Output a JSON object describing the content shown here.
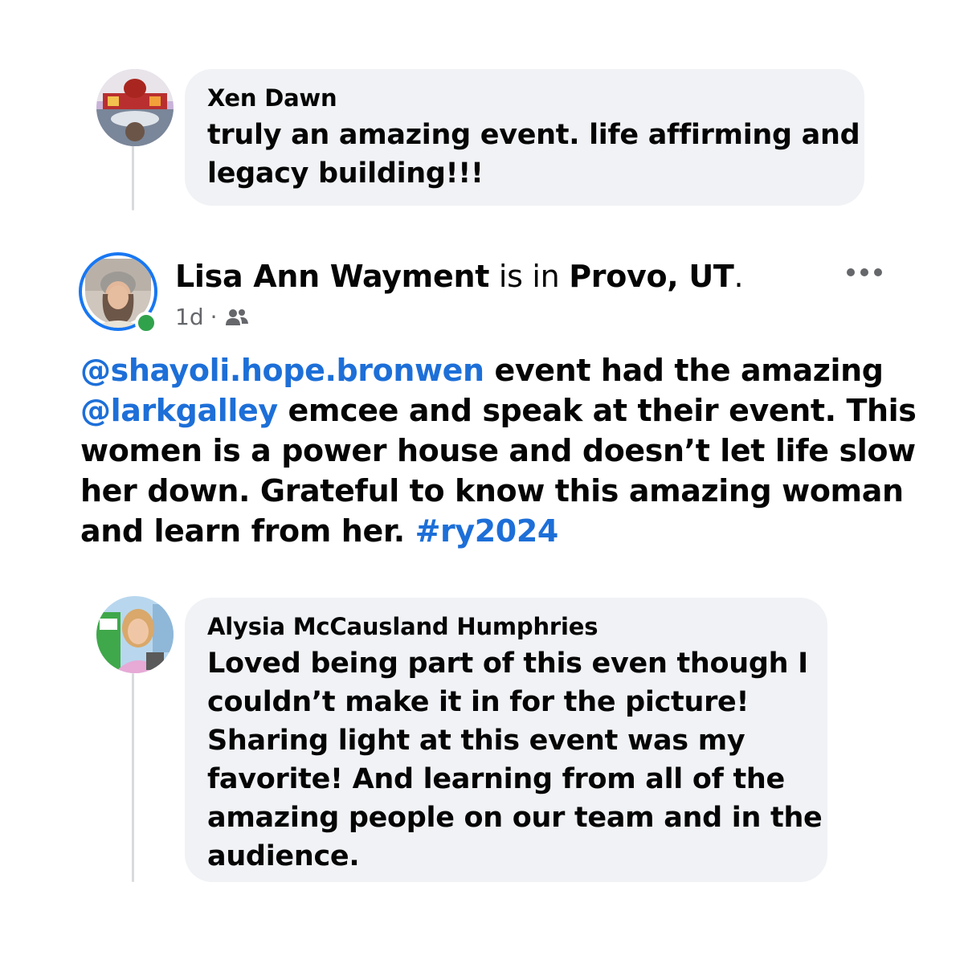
{
  "comment_top": {
    "author": "Xen Dawn",
    "lines": [
      "truly an amazing event. life affirming and",
      "legacy building!!!"
    ]
  },
  "post": {
    "author": "Lisa Ann Wayment",
    "is_in": " is in ",
    "location": "Provo, UT",
    "location_suffix": ".",
    "time": "1d",
    "separator": "·",
    "audience_icon": "friends-icon",
    "more_icon": "more-options-icon",
    "body": {
      "line1": {
        "mention": "@shayoli.hope.bronwen",
        "text": " event had the amazing"
      },
      "line2": {
        "mention": "@larkgalley",
        "text": " emcee and speak at their event. This"
      },
      "line3": "women is a power house and doesn’t let life slow",
      "line4": "her down. Grateful to know this amazing woman",
      "line5": {
        "text": "and learn from her. ",
        "hashtag": "#ry2024"
      }
    }
  },
  "comment_bottom": {
    "author": "Alysia McCausland Humphries",
    "lines": [
      "Loved being part of this even though I",
      "couldn’t make it in for the picture!",
      "Sharing light at this event was my",
      "favorite!  And learning from all of the",
      "amazing people on our team and in the",
      "audience."
    ]
  },
  "colors": {
    "link": "#1d6fd8",
    "bubble": "#f0f2f5",
    "online_dot": "#31a24c",
    "story_ring": "#1877f2",
    "meta_text": "#65676b"
  }
}
